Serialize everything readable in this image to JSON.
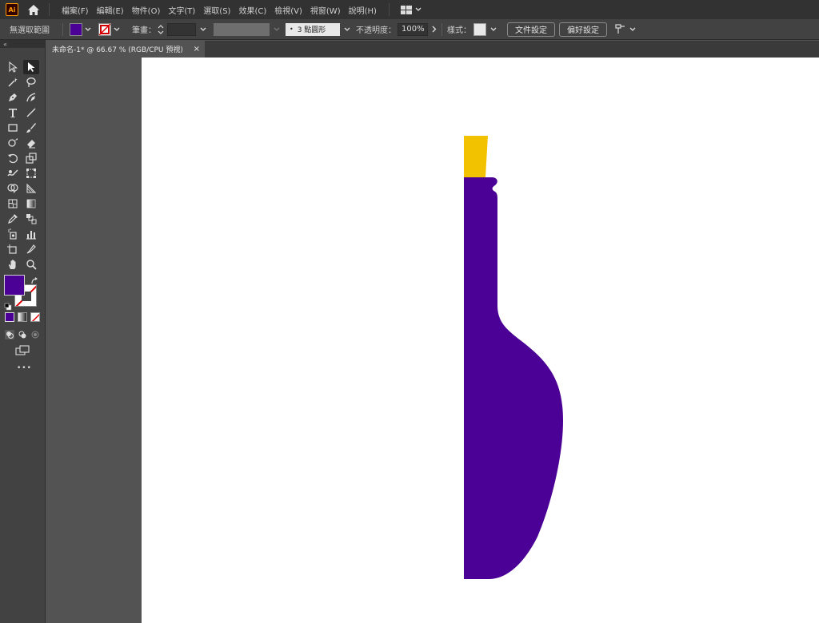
{
  "app": {
    "logo_text": "Ai",
    "menu": [
      "檔案(F)",
      "編輯(E)",
      "物件(O)",
      "文字(T)",
      "選取(S)",
      "效果(C)",
      "檢視(V)",
      "視窗(W)",
      "說明(H)"
    ]
  },
  "control_bar": {
    "selection_label": "無選取範圍",
    "fill_color": "#4b0096",
    "stroke_label": "筆畫：",
    "brush_label": "3 點圓形",
    "opacity_label": "不透明度：",
    "opacity_value": "100%",
    "style_label": "樣式：",
    "doc_setup_button": "文件設定",
    "preferences_button": "偏好設定"
  },
  "document": {
    "tab_title": "未命名-1* @ 66.67 % (RGB/CPU 預視)",
    "tab_close": "×"
  },
  "toolbar": {
    "header": "«",
    "fill_color": "#4b0096",
    "more_label": "•••"
  },
  "artwork": {
    "bottle_color": "#4b0096",
    "cork_color": "#f2c200"
  }
}
